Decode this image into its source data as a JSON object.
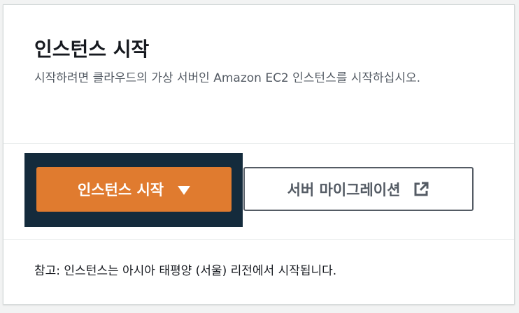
{
  "panel": {
    "title": "인스턴스 시작",
    "description": "시작하려면 클라우드의 가상 서버인 Amazon EC2 인스턴스를 시작하십시오."
  },
  "actions": {
    "launch_label": "인스턴스 시작",
    "launch_icon": "caret-down-icon",
    "migrate_label": "서버 마이그레이션",
    "migrate_icon": "external-link-icon"
  },
  "footer": {
    "note": "참고: 인스턴스는 아시아 태평양 (서울) 리전에서 시작됩니다."
  },
  "colors": {
    "primary": "#e07b2f",
    "focus": "#142b3c",
    "secondary_text": "#545b64"
  }
}
